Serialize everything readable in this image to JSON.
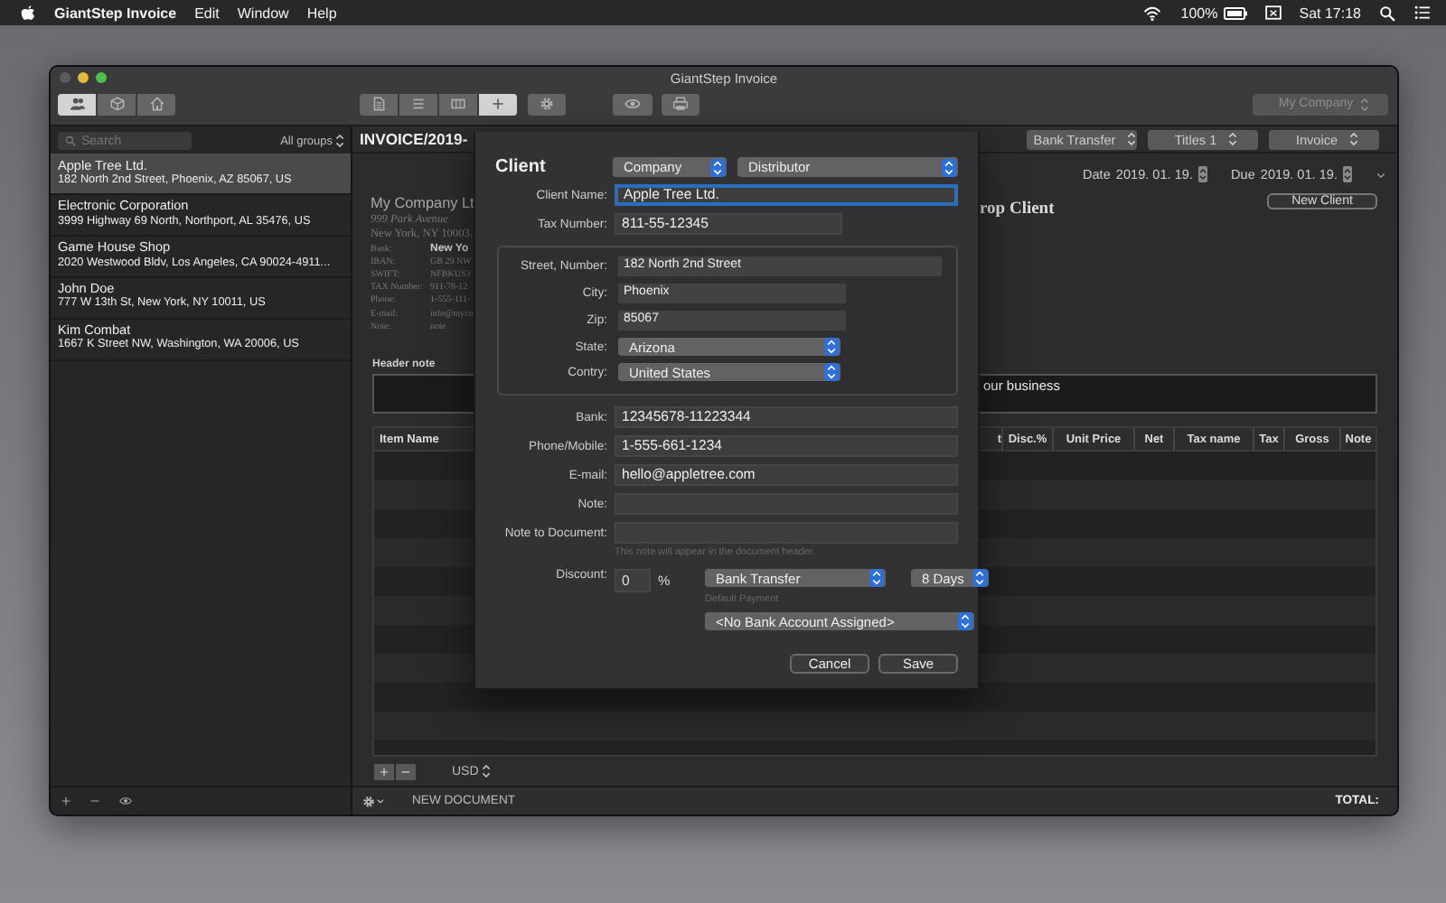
{
  "menubar": {
    "app_name": "GiantStep Invoice",
    "menus": [
      "Edit",
      "Window",
      "Help"
    ],
    "battery": "100%",
    "clock": "Sat 17:18"
  },
  "window": {
    "title": "GiantStep Invoice",
    "view_tabs": [
      {
        "selected": true
      },
      {
        "selected": false
      },
      {
        "selected": false
      }
    ],
    "layout_tabs": [
      {
        "selected": false
      },
      {
        "selected": false
      },
      {
        "selected": false
      },
      {
        "selected": true
      }
    ],
    "company": "My Company"
  },
  "sidebar": {
    "search_placeholder": "Search",
    "group_filter": "All groups",
    "clients": [
      {
        "name": "Apple Tree Ltd.",
        "address": "182 North 2nd Street, Phoenix, AZ 85067, US",
        "selected": true
      },
      {
        "name": "Electronic Corporation",
        "address": "3999 Highway 69 North, Northport, AL 35476, US",
        "selected": false
      },
      {
        "name": "Game House Shop",
        "address": "2020 Westwood Bldv, Los Angeles, CA 90024-4911...",
        "selected": false
      },
      {
        "name": "John Doe",
        "address": "777 W 13th St, New York, NY 10011, US",
        "selected": false
      },
      {
        "name": "Kim Combat",
        "address": "1667 K Street NW, Washington, WA 20006, US",
        "selected": false
      }
    ]
  },
  "document": {
    "number": "INVOICE/2019-",
    "payment": "Bank Transfer",
    "titles": "Titles 1",
    "type": "Invoice",
    "date_label": "Date",
    "date": "2019. 01. 19.",
    "due_label": "Due",
    "due": "2019. 01. 19.",
    "sender_name": "My Company Lt",
    "sender_lines": [
      "999 Park Avenue",
      "New York, NY 10003."
    ],
    "sender_details": [
      {
        "label": "Bank:",
        "value": "New Yo"
      },
      {
        "label": "IBAN:",
        "value": "GB 29 NW"
      },
      {
        "label": "SWIFT:",
        "value": "NFBKUS3"
      },
      {
        "label": "TAX Number:",
        "value": "911-78-12"
      },
      {
        "label": "Phone:",
        "value": "1-555-111-"
      },
      {
        "label": "E-mail:",
        "value": "info@myco"
      },
      {
        "label": "Note:",
        "value": "note"
      }
    ],
    "client_heading": "rop Client",
    "new_client_button": "New Client",
    "header_note_label": "Header note",
    "header_note_text": "our business",
    "columns": [
      "Item Name",
      "t",
      "Disc.%",
      "Unit Price",
      "Net",
      "Tax name",
      "Tax",
      "Gross",
      "Note"
    ],
    "currency": "USD"
  },
  "dialog": {
    "title": "Client",
    "client_type": "Company",
    "category": "Distributor",
    "main_fields": [
      {
        "label": "Client Name:",
        "value": "Apple Tree Ltd.",
        "focused": true
      },
      {
        "label": "Tax Number:",
        "value": "811-55-12345",
        "focused": false
      }
    ],
    "address_fields": [
      {
        "label": "Street, Number:",
        "value": "182 North 2nd Street",
        "kind": "text"
      },
      {
        "label": "City:",
        "value": "Phoenix",
        "kind": "text"
      },
      {
        "label": "Zip:",
        "value": "85067",
        "kind": "text"
      },
      {
        "label": "State:",
        "value": "Arizona",
        "kind": "select"
      },
      {
        "label": "Contry:",
        "value": "United States",
        "kind": "select"
      }
    ],
    "contact_fields": [
      {
        "label": "Bank:",
        "value": "12345678-11223344",
        "focused": false
      },
      {
        "label": "Phone/Mobile:",
        "value": "1-555-661-1234",
        "focused": false
      },
      {
        "label": "E-mail:",
        "value": "hello@appletree.com",
        "focused": false
      },
      {
        "label": "Note:",
        "focused": false
      },
      {
        "label": "Note to Document:",
        "focused": false
      }
    ],
    "note_hint": "This note will appear in the document header.",
    "discount_label": "Discount:",
    "discount": "0",
    "discount_unit": "%",
    "payment": "Bank Transfer",
    "payment_term": "8 Days",
    "payment_hint": "Default Payment",
    "bank_account": "<No Bank Account Assigned>",
    "buttons": [
      "Cancel",
      "Save"
    ]
  },
  "status_bar": {
    "status": "NEW DOCUMENT",
    "total_label": "TOTAL:"
  }
}
